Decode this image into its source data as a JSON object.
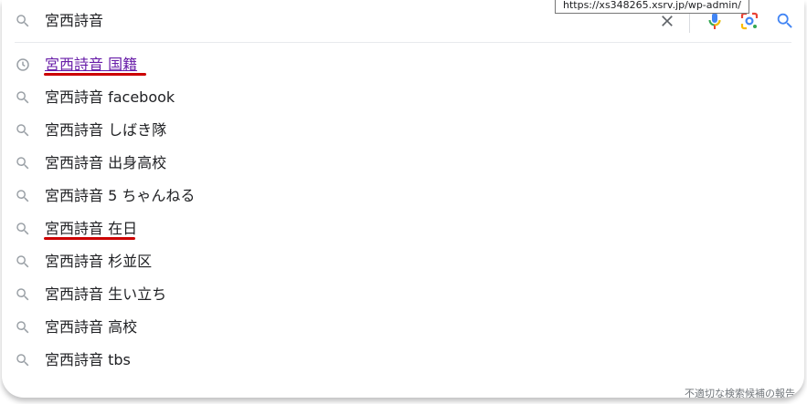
{
  "search": {
    "query": "宮西詩音"
  },
  "suggestions": [
    {
      "text": "宮西詩音 国籍",
      "type": "history",
      "icon": "history-clock-icon"
    },
    {
      "text": "宮西詩音 facebook",
      "type": "search",
      "icon": "search-icon"
    },
    {
      "text": "宮西詩音 しばき隊",
      "type": "search",
      "icon": "search-icon"
    },
    {
      "text": "宮西詩音 出身高校",
      "type": "search",
      "icon": "search-icon"
    },
    {
      "text": "宮西詩音 5 ちゃんねる",
      "type": "search",
      "icon": "search-icon"
    },
    {
      "text": "宮西詩音 在日",
      "type": "search",
      "icon": "search-icon"
    },
    {
      "text": "宮西詩音 杉並区",
      "type": "search",
      "icon": "search-icon"
    },
    {
      "text": "宮西詩音 生い立ち",
      "type": "search",
      "icon": "search-icon"
    },
    {
      "text": "宮西詩音 高校",
      "type": "search",
      "icon": "search-icon"
    },
    {
      "text": "宮西詩音 tbs",
      "type": "search",
      "icon": "search-icon"
    }
  ],
  "footer": {
    "report_label": "不適切な検索候補の報告"
  },
  "tooltip": {
    "url": "https://xs348265.xsrv.jp/wp-admin/"
  },
  "colors": {
    "history_link": "#681da8",
    "annotation_underline": "#cc0000",
    "mic_blue": "#4285f4",
    "mic_red": "#ea4335",
    "lens_yellow": "#fbbc04",
    "lens_green": "#34a853"
  }
}
